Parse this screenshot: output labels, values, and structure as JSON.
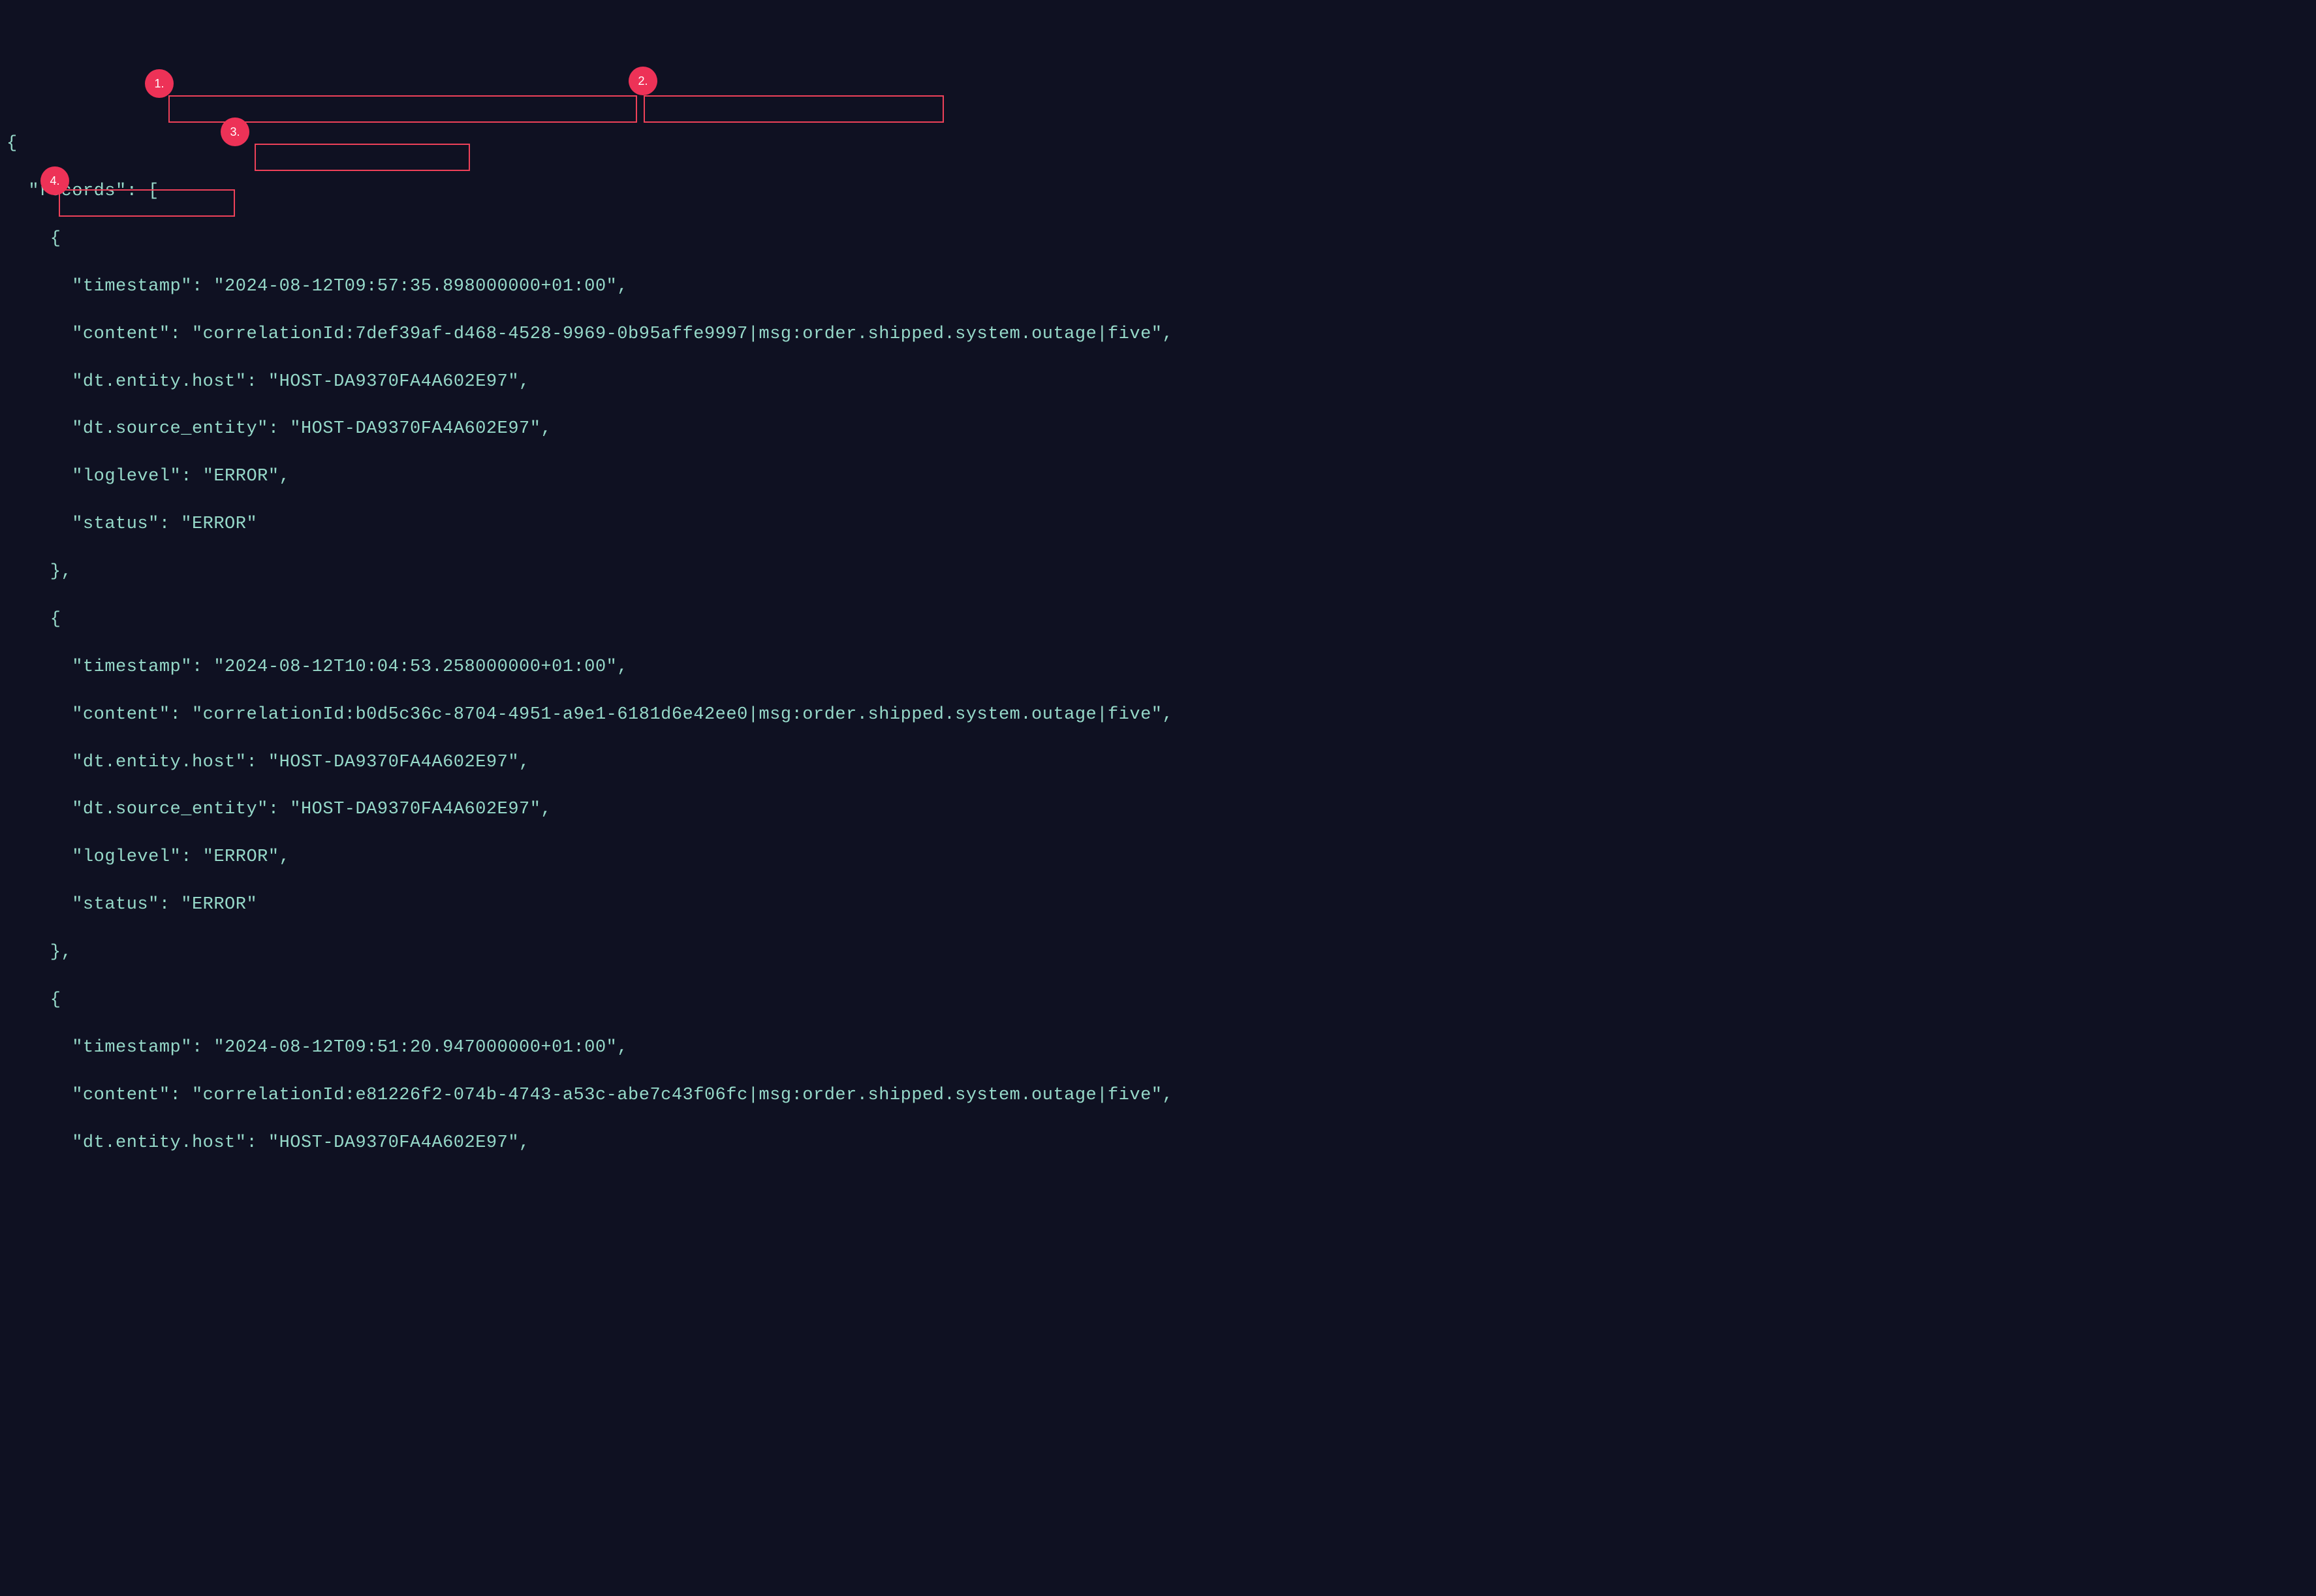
{
  "annotations": {
    "circle1": "1.",
    "circle2": "2.",
    "circle3": "3.",
    "circle4": "4."
  },
  "json": {
    "l1": "{",
    "l2": "  \"records\": [",
    "l3": "    {",
    "l4": "      \"timestamp\": \"2024-08-12T09:57:35.898000000+01:00\",",
    "l5a": "      \"content\": ",
    "l5b": "\"correlationId:7def39af-d468-4528-9969-0b95affe9997|",
    "l5c": "msg:order.shipped.system.outage|",
    "l5d": "five\",",
    "l6a": "      \"dt.entity.host\": ",
    "l6b": "\"HOST-DA9370FA4A602E97\"",
    "l6c": ",",
    "l7a": "      \"dt.source_entity\": ",
    "l7b": "\"HOST-DA9370FA4A602E97\"",
    "l7c": ",",
    "l8": "      \"loglevel\": \"ERROR\",",
    "l9": "      \"status\": \"ERROR\"",
    "l10": "    },",
    "l11": "    {",
    "l12": "      \"timestamp\": \"2024-08-12T10:04:53.258000000+01:00\",",
    "l13": "      \"content\": \"correlationId:b0d5c36c-8704-4951-a9e1-6181d6e42ee0|msg:order.shipped.system.outage|five\",",
    "l14": "      \"dt.entity.host\": \"HOST-DA9370FA4A602E97\",",
    "l15": "      \"dt.source_entity\": \"HOST-DA9370FA4A602E97\",",
    "l16": "      \"loglevel\": \"ERROR\",",
    "l17": "      \"status\": \"ERROR\"",
    "l18": "    },",
    "l19": "    {",
    "l20": "      \"timestamp\": \"2024-08-12T09:51:20.947000000+01:00\",",
    "l21": "      \"content\": \"correlationId:e81226f2-074b-4743-a53c-abe7c43f06fc|msg:order.shipped.system.outage|five\",",
    "l22": "      \"dt.entity.host\": \"HOST-DA9370FA4A602E97\","
  }
}
